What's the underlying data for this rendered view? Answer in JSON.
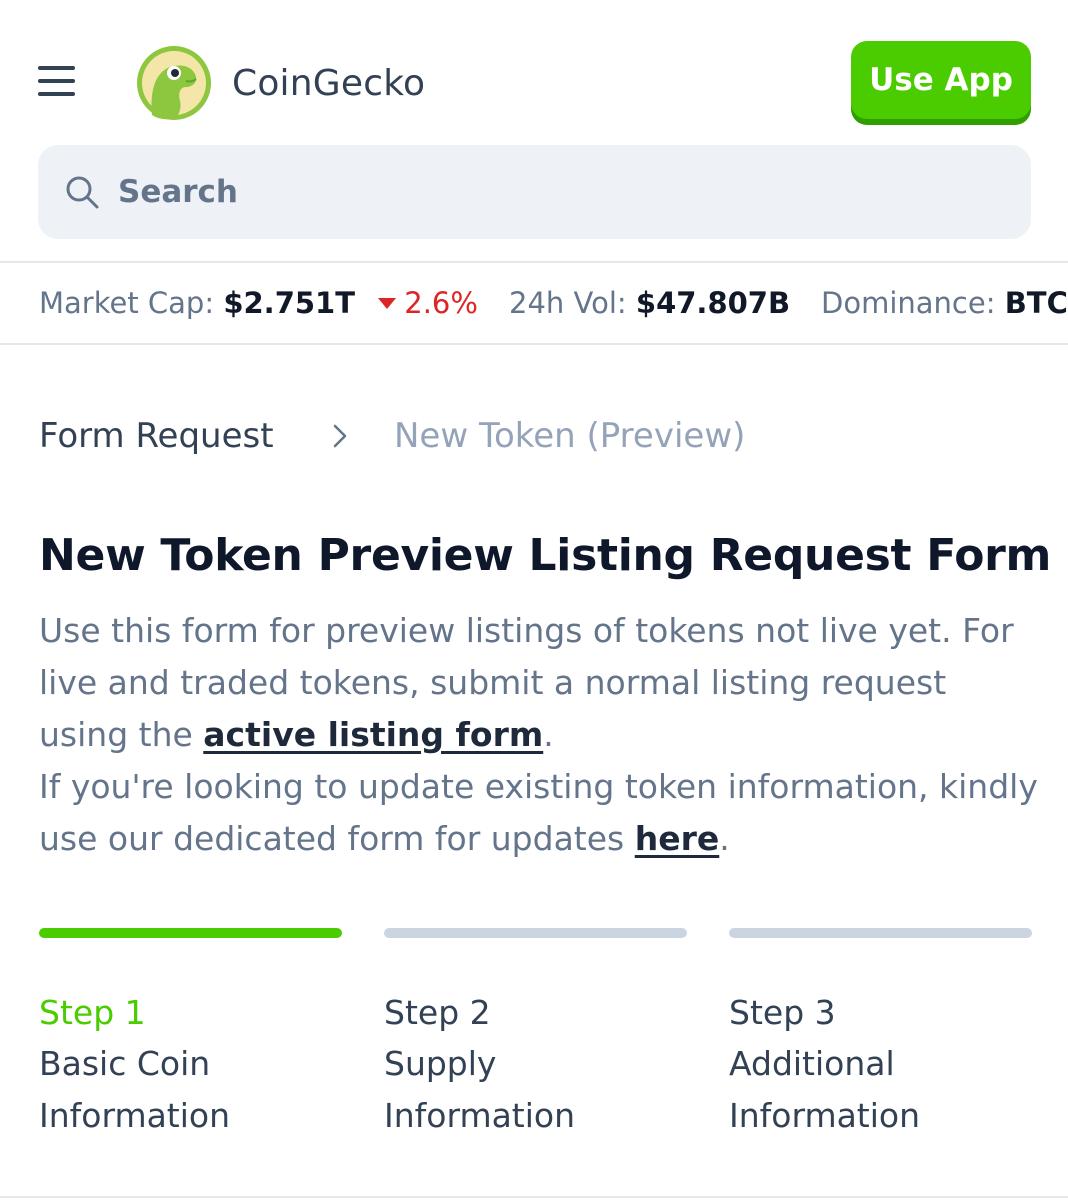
{
  "header": {
    "brand_name": "CoinGecko",
    "use_app_label": "Use App",
    "brand_color": "#4bcc00"
  },
  "search": {
    "placeholder": "Search"
  },
  "stats": {
    "market_cap_label": "Market Cap:",
    "market_cap_value": "$2.751T",
    "market_cap_change": "2.6%",
    "vol_label": "24h Vol:",
    "vol_value": "$47.807B",
    "dominance_label": "Dominance:",
    "dominance_value": "BTC",
    "negative_color": "#dc2626"
  },
  "breadcrumb": {
    "items": [
      {
        "label": "Form Request"
      },
      {
        "label": "New Token (Preview)"
      }
    ]
  },
  "page": {
    "title": "New Token Preview Listing Request Form",
    "desc_line1": "Use this form for preview listings of tokens not live yet. For live and traded tokens, submit a normal listing request using the ",
    "desc_link1": "active listing form",
    "desc_line2": "If you're looking to update existing token information, kindly use our dedicated form for updates ",
    "desc_link2": "here",
    "period": "."
  },
  "steps": [
    {
      "num": "Step 1",
      "label": "Basic Coin Information",
      "active": true
    },
    {
      "num": "Step 2",
      "label": "Supply Information",
      "active": false
    },
    {
      "num": "Step 3",
      "label": "Additional Information",
      "active": false
    }
  ]
}
